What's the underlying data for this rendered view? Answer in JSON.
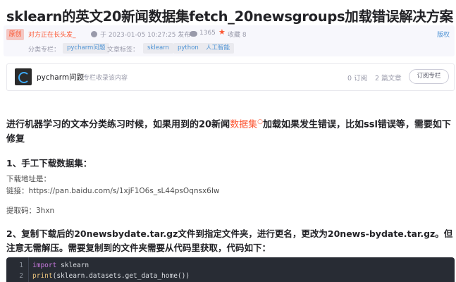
{
  "article": {
    "title": "sklearn的英文20新闻数据集fetch_20newsgroups加载错误解决方案"
  },
  "meta": {
    "badge": "原创",
    "author": "对方正在长头发_",
    "date": "于 2023-01-05 10:27:25 发布",
    "views": "1365",
    "collect": "收藏 8",
    "copyright": "版权",
    "column_label": "分类专栏：",
    "column_tag": "pycharm问题",
    "tags_label": "文章标签：",
    "tags": [
      "sklearn",
      "python",
      "人工智能"
    ]
  },
  "column_card": {
    "name": "pycharm问题",
    "desc": "专栏收录该内容",
    "subscriptions": "0 订阅",
    "articles": "2 篇文章",
    "subscribe_button": "订阅专栏"
  },
  "content": {
    "para1_a": "进行机器学习的文本分类练习时候，如果用到的20新闻",
    "para1_kw": "数据集",
    "para1_b": "加载如果发生错误，比如ssl错误等，需要如下修复",
    "h1": "1、手工下载数据集：",
    "download_label": "下载地址是：",
    "link": "链接：https://pan.baidu.com/s/1xjF1O6s_sL44psOqnsx6Iw",
    "code_label": "提取码：3hxn",
    "h2": "2、复制下载后的20newsbydate.tar.gz文件到指定文件夹，进行更名，更改为20news-bydate.tar.gz。但注意无需解压。需要复制到的文件夹需要从代码里获取，代码如下："
  },
  "code": {
    "line_numbers": [
      "1",
      "2"
    ],
    "line1_kw": "import",
    "line1_rest": " sklearn",
    "line2_fn": "print",
    "line2_rest": "(sklearn.datasets.get_data_home())"
  },
  "colors": {
    "accent": "#fc5531",
    "link": "#5094d5",
    "code_bg": "#282c34"
  }
}
